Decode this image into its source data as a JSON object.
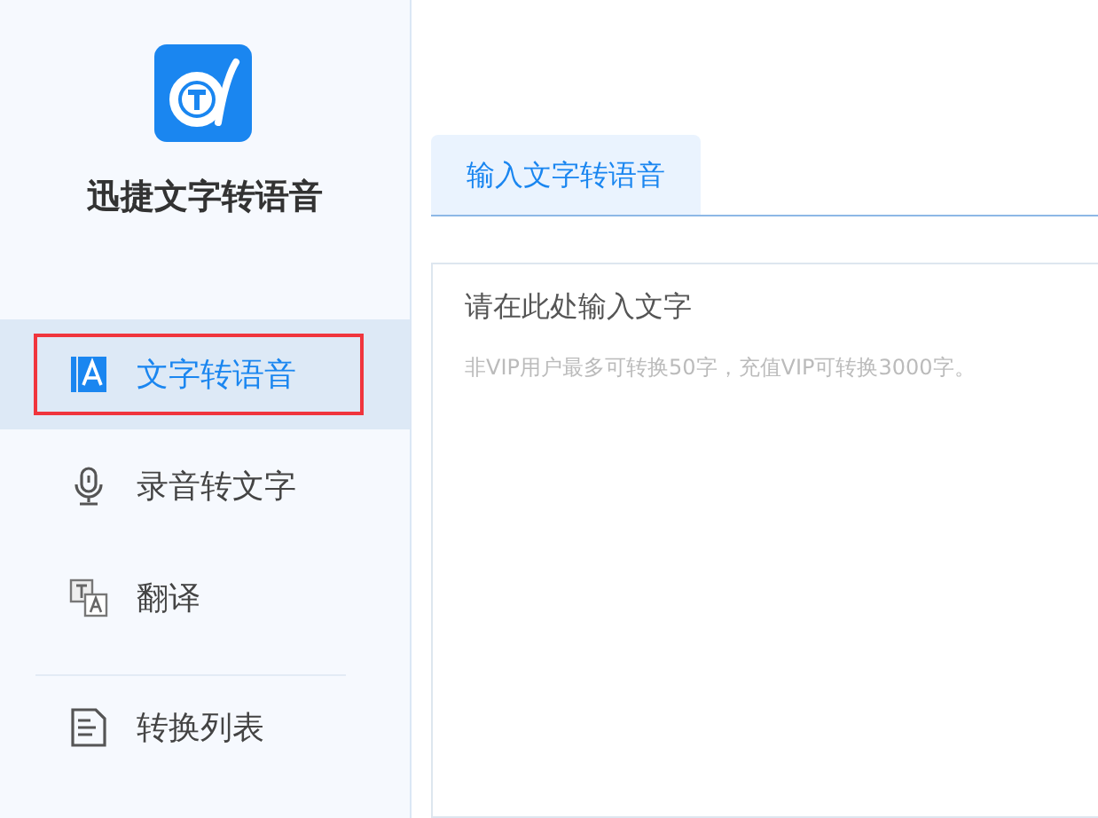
{
  "app": {
    "title": "迅捷文字转语音"
  },
  "sidebar": {
    "items": [
      {
        "label": "文字转语音",
        "kind": "text",
        "selected": true
      },
      {
        "label": "录音转文字",
        "kind": "mic",
        "selected": false
      },
      {
        "label": "翻译",
        "kind": "translate",
        "selected": false
      },
      {
        "label": "转换列表",
        "kind": "list",
        "selected": false,
        "divider_before": true
      }
    ]
  },
  "tabs": [
    {
      "label": "输入文字转语音",
      "selected": true
    }
  ],
  "editor": {
    "placeholder": "请在此处输入文字",
    "hint": "非VIP用户最多可转换50字，充值VIP可转换3000字。"
  }
}
